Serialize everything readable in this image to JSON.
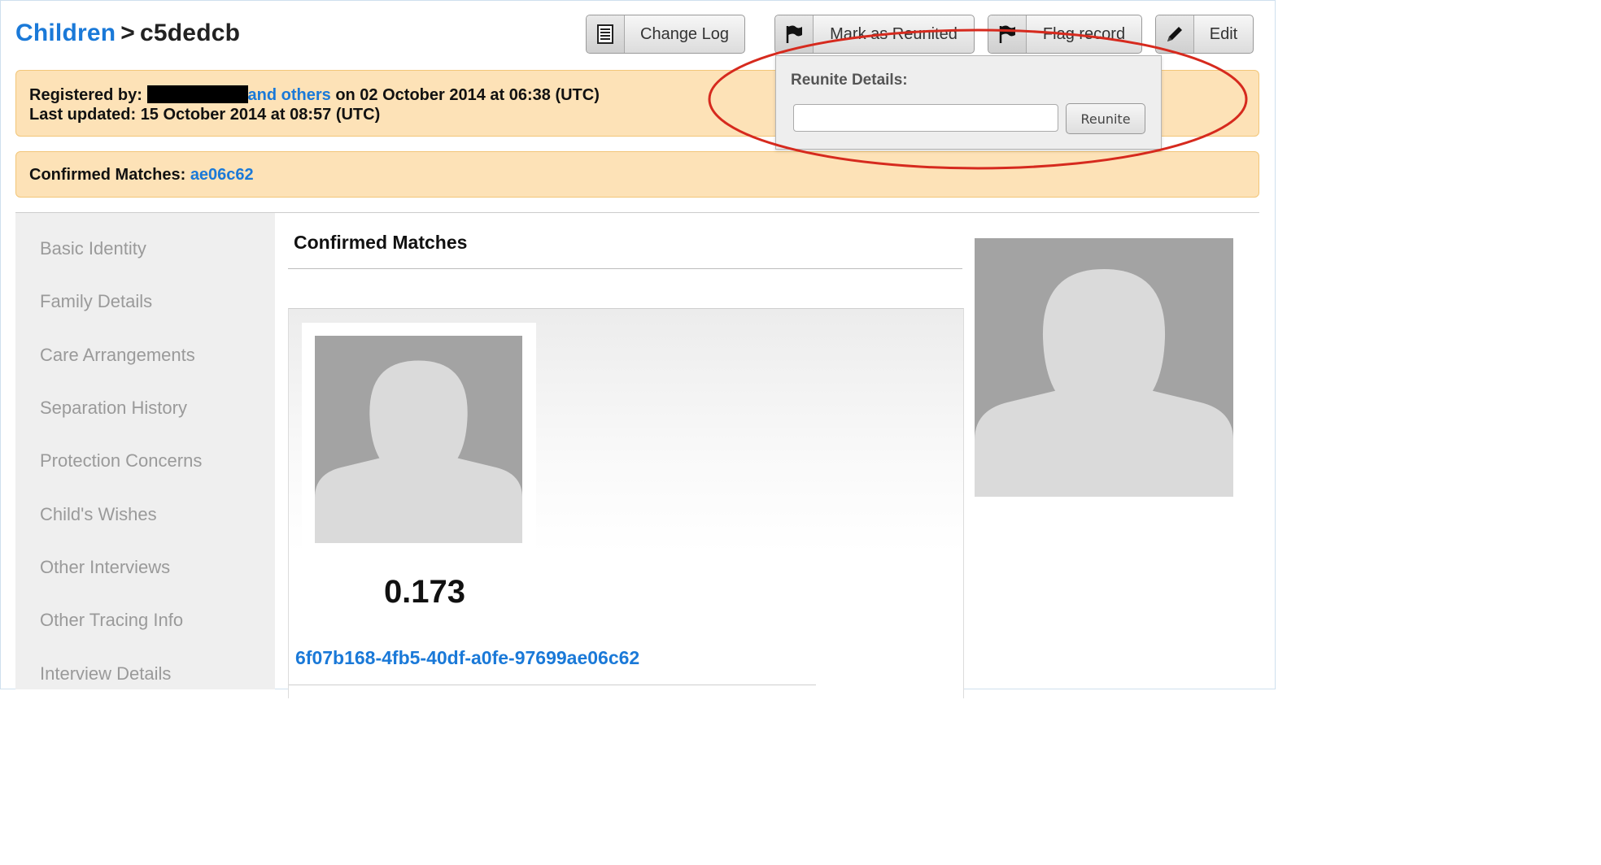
{
  "breadcrumb": {
    "section": "Children",
    "separator": ">",
    "record_id": "c5dedcb"
  },
  "toolbar": {
    "change_log": {
      "label": "Change Log",
      "icon": "document-list-icon"
    },
    "mark_reunited": {
      "label": "Mark as Reunited",
      "icon": "flag-icon"
    },
    "flag_record": {
      "label": "Flag record",
      "icon": "flag-icon"
    },
    "edit": {
      "label": "Edit",
      "icon": "pencil-icon"
    }
  },
  "registration": {
    "registered_by_label": "Registered by:",
    "others_link": "and others",
    "registered_on": "on 02 October 2014 at 06:38 (UTC)",
    "last_updated_label": "Last updated:",
    "last_updated": "15 October 2014 at 08:57 (UTC)"
  },
  "confirmed_notice": {
    "label": "Confirmed Matches:",
    "match_link": "ae06c62"
  },
  "reunite_popover": {
    "title": "Reunite Details:",
    "input_value": "",
    "button_label": "Reunite"
  },
  "sidebar": {
    "items": [
      {
        "label": "Basic Identity"
      },
      {
        "label": "Family Details"
      },
      {
        "label": "Care Arrangements"
      },
      {
        "label": "Separation History"
      },
      {
        "label": "Protection Concerns"
      },
      {
        "label": "Child's Wishes"
      },
      {
        "label": "Other Interviews"
      },
      {
        "label": "Other Tracing Info"
      },
      {
        "label": "Interview Details"
      }
    ]
  },
  "main": {
    "heading": "Confirmed Matches",
    "match": {
      "score": "0.173",
      "id": "6f07b168-4fb5-40df-a0fe-97699ae06c62"
    }
  },
  "colors": {
    "link": "#1a79d8",
    "notice_bg": "#fde2b7",
    "notice_border": "#f2c679",
    "highlight": "#d62a1e",
    "sidebar_bg": "#efefef"
  }
}
